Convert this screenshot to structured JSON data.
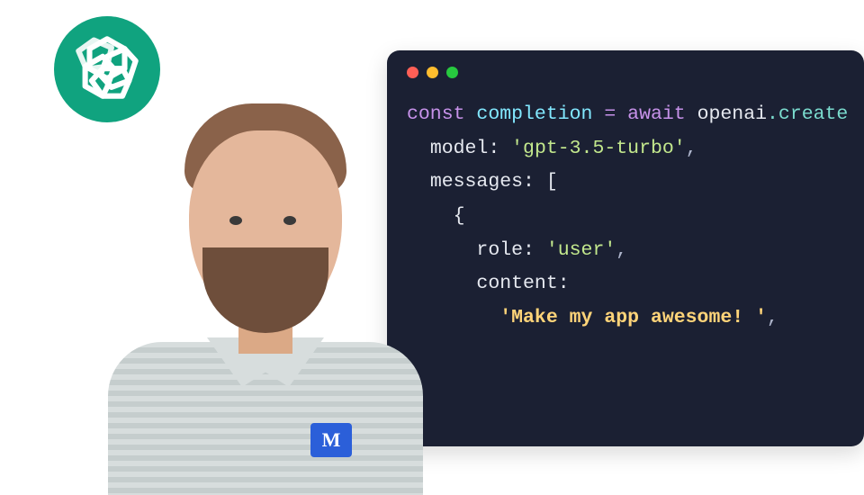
{
  "logo": {
    "name": "openai"
  },
  "window": {
    "traffic": [
      "close",
      "minimize",
      "zoom"
    ]
  },
  "code": {
    "kw_const": "const",
    "var_name": "completion",
    "op_eq": "=",
    "kw_await": "await",
    "obj": "openai",
    "dot": ".",
    "fn": "create",
    "prop_model": "model",
    "val_model": "'gpt-3.5-turbo'",
    "prop_messages": "messages",
    "bracket_open": "[",
    "brace_open": "{",
    "prop_role": "role",
    "val_role": "'user'",
    "prop_content": "content",
    "val_content": "'Make my app awesome! '",
    "colon": ":",
    "comma": ","
  },
  "person": {
    "badge_letter": "M"
  }
}
